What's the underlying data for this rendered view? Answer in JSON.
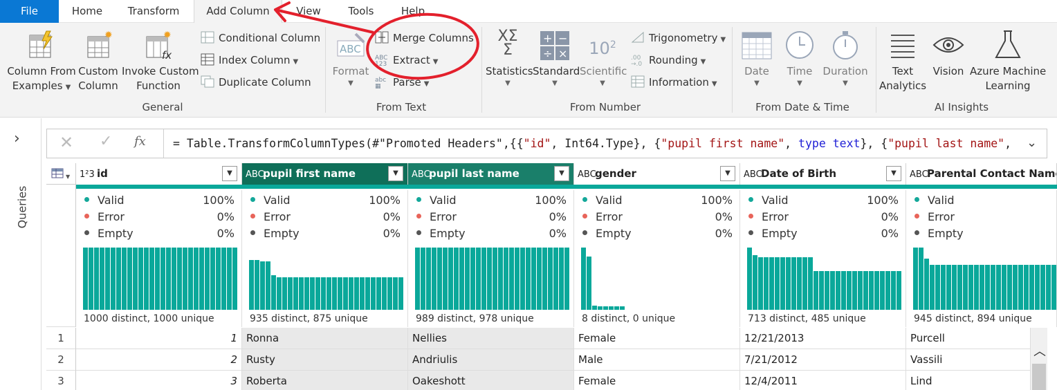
{
  "tabs": {
    "file": "File",
    "home": "Home",
    "transform": "Transform",
    "add_column": "Add Column",
    "view": "View",
    "tools": "Tools",
    "help": "Help"
  },
  "ribbon": {
    "column_from_examples": [
      "Column From",
      "Examples"
    ],
    "custom_column": [
      "Custom",
      "Column"
    ],
    "invoke_custom_function": [
      "Invoke Custom",
      "Function"
    ],
    "conditional_column": "Conditional Column",
    "index_column": "Index Column",
    "duplicate_column": "Duplicate Column",
    "general_group": "General",
    "format": "Format",
    "merge_columns": "Merge Columns",
    "extract": "Extract",
    "parse": "Parse",
    "from_text_group": "From Text",
    "statistics": "Statistics",
    "standard": "Standard",
    "scientific": "Scientific",
    "trigonometry": "Trigonometry",
    "rounding": "Rounding",
    "information": "Information",
    "from_number_group": "From Number",
    "date": "Date",
    "time": "Time",
    "duration": "Duration",
    "from_date_time_group": "From Date & Time",
    "text_analytics": [
      "Text",
      "Analytics"
    ],
    "vision": "Vision",
    "azure_ml": [
      "Azure Machine",
      "Learning"
    ],
    "ai_insights_group": "AI Insights"
  },
  "sidebar": {
    "label": "Queries"
  },
  "formula": {
    "text_prefix": "= Table.TransformColumnTypes(#\"Promoted Headers\",{{",
    "s1": "\"id\"",
    "t1": ", Int64.Type}, {",
    "s2": "\"pupil first name\"",
    "t2": ", ",
    "k1": "type text",
    "t3": "}, {",
    "s3": "\"pupil last name\"",
    "t4": ","
  },
  "columns": [
    {
      "type": "1²3",
      "name": "id",
      "valid": "100%",
      "error": "0%",
      "empty": "0%",
      "dist": "1000 distinct, 1000 unique",
      "hist": [
        100,
        100,
        100,
        100,
        100,
        100,
        100,
        100,
        100,
        100,
        100,
        100,
        100,
        100,
        100,
        100,
        100,
        100,
        100,
        100,
        100,
        100,
        100,
        100,
        100,
        100,
        100,
        100
      ]
    },
    {
      "type": "ABC",
      "name": "pupil first name",
      "valid": "100%",
      "error": "0%",
      "empty": "0%",
      "dist": "935 distinct, 875 unique",
      "hist": [
        80,
        80,
        78,
        78,
        56,
        52,
        52,
        52,
        52,
        52,
        52,
        52,
        52,
        52,
        52,
        52,
        52,
        52,
        52,
        52,
        52,
        52,
        52,
        52,
        52,
        52,
        52,
        52
      ]
    },
    {
      "type": "ABC",
      "name": "pupil last name",
      "valid": "100%",
      "error": "0%",
      "empty": "0%",
      "dist": "989 distinct, 978 unique",
      "hist": [
        100,
        100,
        100,
        100,
        100,
        100,
        100,
        100,
        100,
        100,
        100,
        100,
        100,
        100,
        100,
        100,
        100,
        100,
        100,
        100,
        100,
        100,
        100,
        100,
        100,
        100,
        100,
        100
      ]
    },
    {
      "type": "ABC",
      "name": "gender",
      "valid": "100%",
      "error": "0%",
      "empty": "0%",
      "dist": "8 distinct, 0 unique",
      "hist": [
        100,
        86,
        7,
        6,
        6,
        6,
        6,
        6
      ]
    },
    {
      "type": "ABC",
      "name": "Date of Birth",
      "valid": "100%",
      "error": "0%",
      "empty": "0%",
      "dist": "713 distinct, 485 unique",
      "hist": [
        100,
        88,
        84,
        84,
        84,
        84,
        84,
        84,
        84,
        84,
        84,
        84,
        62,
        62,
        62,
        62,
        62,
        62,
        62,
        62,
        62,
        62,
        62,
        62,
        62,
        62,
        62,
        62
      ]
    },
    {
      "type": "ABC",
      "name": "Parental Contact Name",
      "valid": "",
      "error": "",
      "empty": "",
      "dist": "945 distinct, 894 unique",
      "hist": [
        100,
        100,
        82,
        72,
        72,
        72,
        72,
        72,
        72,
        72,
        72,
        72,
        72,
        72,
        72,
        72,
        72,
        72,
        72,
        72,
        72,
        72,
        72,
        72,
        72,
        72,
        72,
        72
      ]
    }
  ],
  "quality_labels": {
    "valid": "Valid",
    "error": "Error",
    "empty": "Empty"
  },
  "rows": [
    {
      "n": "1",
      "id": "1",
      "first": "Ronna",
      "last": "Nellies",
      "gender": "Female",
      "dob": "12/21/2013",
      "parent": "Purcell"
    },
    {
      "n": "2",
      "id": "2",
      "first": "Rusty",
      "last": "Andriulis",
      "gender": "Male",
      "dob": "7/21/2012",
      "parent": "Vassili"
    },
    {
      "n": "3",
      "id": "3",
      "first": "Roberta",
      "last": "Oakeshott",
      "gender": "Female",
      "dob": "12/4/2011",
      "parent": "Lind"
    }
  ],
  "colors": {
    "file_tab": "#0a78d4",
    "selected_column": "#0f6f59",
    "quality_bar": "#0aa89a",
    "annotation": "#e3202c",
    "valid_dot": "#14a89a",
    "error_dot": "#e8645a",
    "empty_dot": "#555555"
  }
}
